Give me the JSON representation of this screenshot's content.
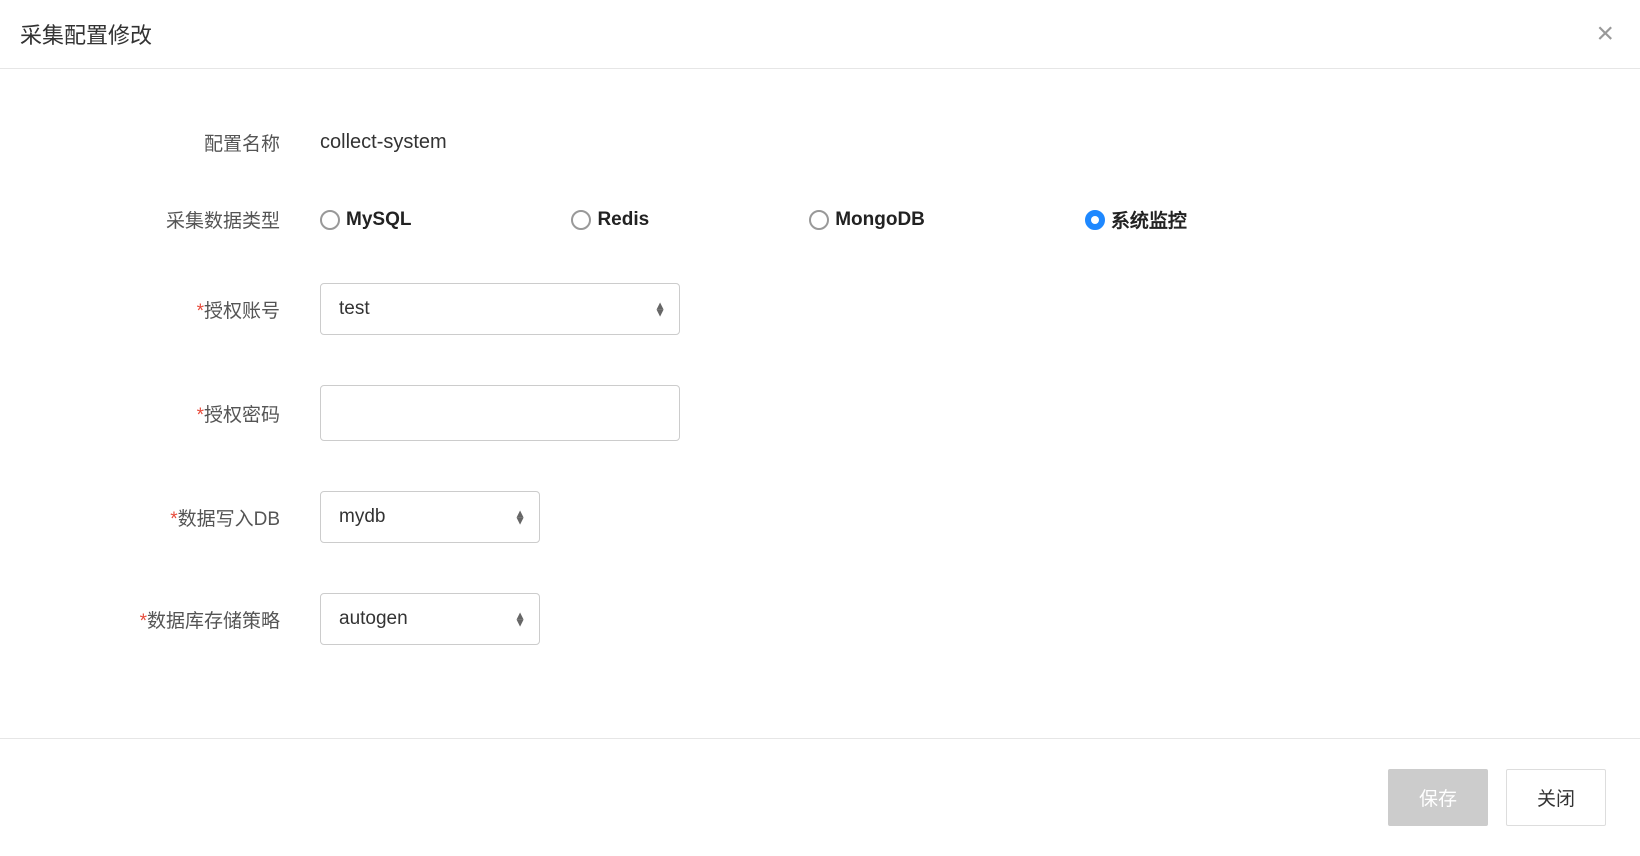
{
  "modal": {
    "title": "采集配置修改"
  },
  "form": {
    "config_name": {
      "label": "配置名称",
      "value": "collect-system"
    },
    "data_type": {
      "label": "采集数据类型",
      "options": [
        "MySQL",
        "Redis",
        "MongoDB",
        "系统监控"
      ],
      "selected": "系统监控"
    },
    "auth_account": {
      "label": "授权账号",
      "value": "test"
    },
    "auth_password": {
      "label": "授权密码",
      "value": ""
    },
    "write_db": {
      "label": "数据写入DB",
      "value": "mydb"
    },
    "storage_policy": {
      "label": "数据库存储策略",
      "value": "autogen"
    }
  },
  "footer": {
    "save_label": "保存",
    "close_label": "关闭"
  }
}
